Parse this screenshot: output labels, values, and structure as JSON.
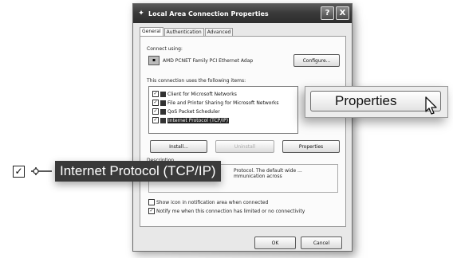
{
  "dialog": {
    "title": "Local Area Connection Properties",
    "help_icon": "?",
    "close_icon": "X",
    "tabs": [
      {
        "label": "General"
      },
      {
        "label": "Authentication"
      },
      {
        "label": "Advanced"
      }
    ],
    "connect_using_label": "Connect using:",
    "adapter_name": "AMD PCNET Family PCI Ethernet Adap",
    "configure_label": "Configure...",
    "items_label": "This connection uses the following items:",
    "items": [
      {
        "label": "Client for Microsoft Networks",
        "checked": "✓"
      },
      {
        "label": "File and Printer Sharing for Microsoft Networks",
        "checked": "✓"
      },
      {
        "label": "QoS Packet Scheduler",
        "checked": "✓"
      },
      {
        "label": "Internet Protocol (TCP/IP)",
        "checked": "✓"
      }
    ],
    "install_label": "Install...",
    "uninstall_label": "Uninstall",
    "properties_label": "Properties",
    "description_label": "Description",
    "description_text": "Protocol. The default wide ... mmunication across",
    "show_icon_label": "Show icon in notification area when connected",
    "notify_label": "Notify me when this connection has limited or no connectivity",
    "notify_checked": "✓",
    "ok_label": "OK",
    "cancel_label": "Cancel"
  },
  "callout": {
    "properties_label": "Properties"
  },
  "zoom_row": {
    "checked": "✓",
    "label": "Internet Protocol (TCP/IP)"
  }
}
